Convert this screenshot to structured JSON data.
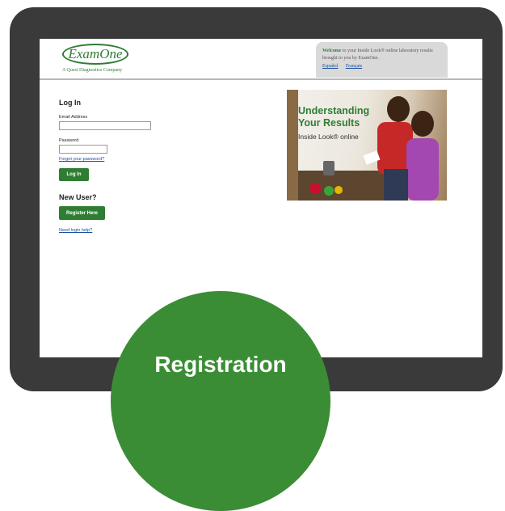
{
  "header": {
    "logo_text": "ExamOne",
    "tagline": "A Quest Diagnostics Company",
    "welcome_bold": "Welcome",
    "welcome_text": "to your Inside Look® online laboratory results brought to you by ExamOne.",
    "languages": [
      "Español",
      "Français"
    ]
  },
  "login": {
    "heading": "Log In",
    "email_label": "Email Address",
    "email_value": "",
    "password_label": "Password",
    "password_value": "",
    "forgot_link": "Forgot your password?",
    "login_button": "Log In"
  },
  "new_user": {
    "heading": "New User?",
    "register_button": "Register Here",
    "help_link": "Need login help?"
  },
  "promo": {
    "title_line1": "Understanding",
    "title_line2": "Your Results",
    "subtitle": "Inside Look® online"
  },
  "badge": {
    "text": "Registration"
  },
  "colors": {
    "brand_green": "#2e7d32",
    "button_green": "#2f7d33",
    "badge_green": "#3a8d34",
    "link_blue": "#1a4f9c",
    "device_frame": "#3a3a3a"
  }
}
